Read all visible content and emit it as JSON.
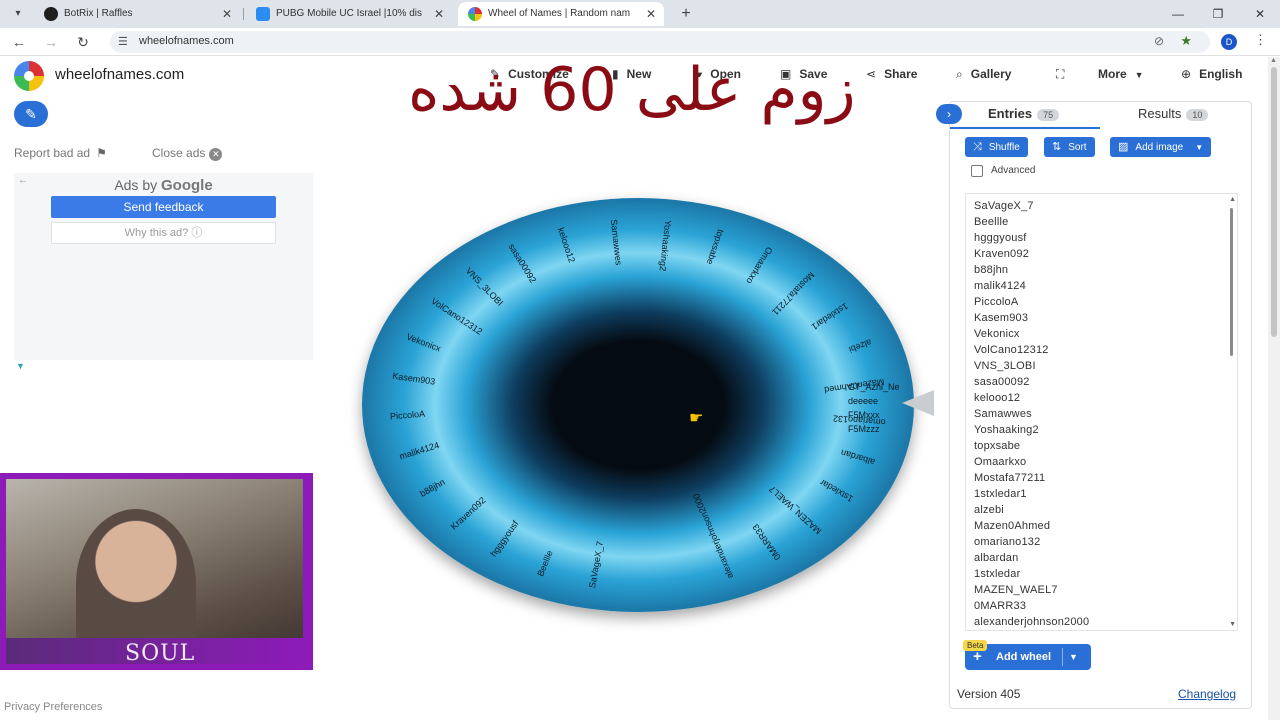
{
  "browser": {
    "tabs": [
      {
        "title": "BotRix | Raffles",
        "favicon_color": "#1f1f1f"
      },
      {
        "title": "PUBG Mobile UC Israel |10% dis",
        "favicon_color": "#2d8cf0"
      },
      {
        "title": "Wheel of Names | Random nam",
        "favicon_color": "#db3236"
      }
    ],
    "url": "wheelofnames.com",
    "profile_initial": "D",
    "icons": {
      "back": "arrow-left-icon",
      "forward": "arrow-right-icon",
      "reload": "reload-icon",
      "bookmark": "star-icon"
    }
  },
  "site": {
    "title": "wheelofnames.com",
    "menu": {
      "customize": "Customize",
      "new": "New",
      "open": "Open",
      "save": "Save",
      "share": "Share",
      "gallery": "Gallery",
      "more": "More",
      "language": "English"
    },
    "overlay_text": "زوم على 60 شده"
  },
  "left": {
    "report_bad_ad": "Report bad ad",
    "close_ads": "Close ads",
    "ads_by": "Ads by",
    "google": "Google",
    "send_feedback": "Send feedback",
    "why_this_ad": "Why this ad?",
    "webcam_label": "SOUL",
    "privacy": "Privacy Preferences"
  },
  "wheel": {
    "top_labels": [
      "SaVageX_7",
      "Beellle",
      "hgggyousf",
      "Kraven092",
      "b88jhn",
      "malik4124",
      "PiccoloA",
      "Kasem903",
      "Vekonicx",
      "VolCano12312",
      "VNS_3LOBI",
      "sasa00092",
      "kelooo12",
      "Samawwes",
      "Yoshaaking2",
      "topxsabe",
      "Omaarkxo",
      "Mostafa77211",
      "1stxledar1",
      "alzebi",
      "Mazen0Ahmed",
      "omariano132",
      "albardan",
      "1stxledar",
      "MAZEN_WAEL7",
      "0MARR33",
      "alexanderjohnson2000"
    ],
    "right_labels": [
      "GT_Azhl_Ne",
      "deeeee",
      "F5Mxxx",
      "F5Mzzz"
    ]
  },
  "panel": {
    "entries_tab": "Entries",
    "entries_count": "75",
    "results_tab": "Results",
    "results_count": "10",
    "shuffle": "Shuffle",
    "sort": "Sort",
    "add_image": "Add image",
    "advanced": "Advanced",
    "entries": [
      "SaVageX_7",
      "Beellle",
      "hgggyousf",
      "Kraven092",
      "b88jhn",
      "malik4124",
      "PiccoloA",
      "Kasem903",
      "Vekonicx",
      "VolCano12312",
      "VNS_3LOBI",
      "sasa00092",
      "kelooo12",
      "Samawwes",
      "Yoshaaking2",
      "topxsabe",
      "Omaarkxo",
      "Mostafa77211",
      "1stxledar1",
      "alzebi",
      "Mazen0Ahmed",
      "omariano132",
      "albardan",
      "1stxledar",
      "MAZEN_WAEL7",
      "0MARR33",
      "alexanderjohnson2000"
    ],
    "beta": "Beta",
    "add_wheel": "Add wheel",
    "version": "Version 405",
    "changelog": "Changelog"
  },
  "colors": {
    "accent": "#2a6fd6",
    "overlay": "#8b0b14",
    "webcam_border": "#8d1bb8"
  }
}
